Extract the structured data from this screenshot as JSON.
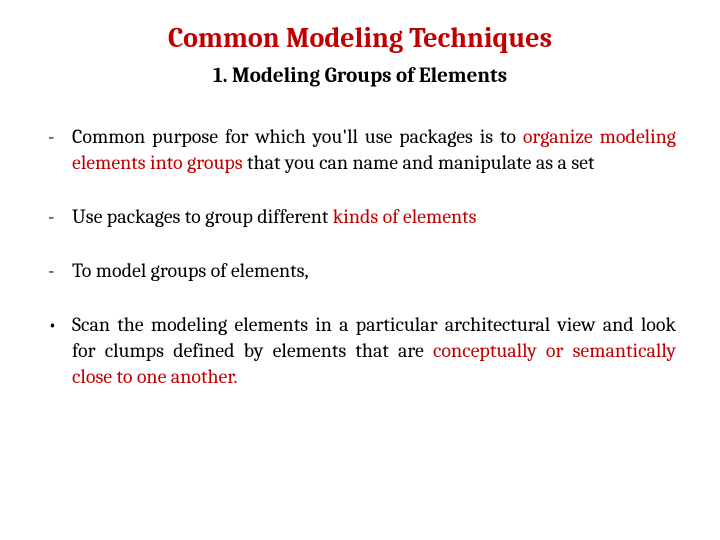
{
  "title": "Common Modeling Techniques",
  "subtitle": "1.   Modeling Groups of Elements",
  "items": [
    {
      "marker": "dash",
      "segments": [
        {
          "text": "Common purpose for which you'll use packages is to ",
          "hl": false
        },
        {
          "text": "organize modeling elements into groups",
          "hl": true
        },
        {
          "text": " that you can name and manipulate as a set",
          "hl": false
        }
      ]
    },
    {
      "marker": "dash",
      "segments": [
        {
          "text": "Use packages to group different ",
          "hl": false
        },
        {
          "text": "kinds of elements",
          "hl": true
        }
      ]
    },
    {
      "marker": "dash",
      "segments": [
        {
          "text": "To model groups of elements,",
          "hl": false
        }
      ]
    },
    {
      "marker": "bullet",
      "segments": [
        {
          "text": "Scan the modeling elements in a particular architectural view and look for clumps defined by elements that are ",
          "hl": false
        },
        {
          "text": "conceptually or semantically close to one another.",
          "hl": true
        }
      ]
    }
  ]
}
